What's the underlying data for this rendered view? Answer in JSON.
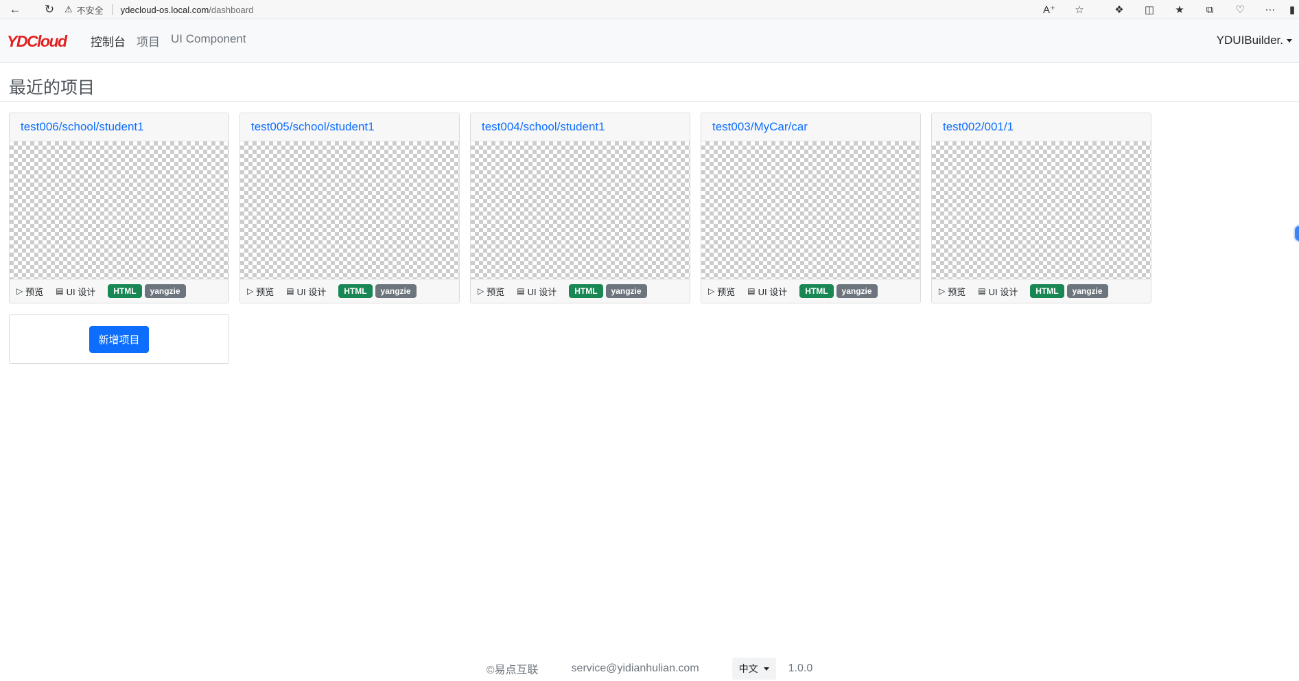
{
  "browser": {
    "insecure_label": "不安全",
    "url_host": "ydecloud-os.local.com",
    "url_path": "/dashboard"
  },
  "navbar": {
    "brand": "YDCloud",
    "links": [
      {
        "label": "控制台",
        "active": true
      },
      {
        "label": "项目",
        "active": false
      },
      {
        "label": "UI Component",
        "active": false
      }
    ],
    "user": "YDUIBuilder."
  },
  "page": {
    "title": "最近的项目"
  },
  "projects": [
    {
      "title": "test006/school/student1",
      "preview": "预览",
      "design": "UI 设计",
      "type": "HTML",
      "owner": "yangzie"
    },
    {
      "title": "test005/school/student1",
      "preview": "预览",
      "design": "UI 设计",
      "type": "HTML",
      "owner": "yangzie"
    },
    {
      "title": "test004/school/student1",
      "preview": "预览",
      "design": "UI 设计",
      "type": "HTML",
      "owner": "yangzie"
    },
    {
      "title": "test003/MyCar/car",
      "preview": "预览",
      "design": "UI 设计",
      "type": "HTML",
      "owner": "yangzie"
    },
    {
      "title": "test002/001/1",
      "preview": "预览",
      "design": "UI 设计",
      "type": "HTML",
      "owner": "yangzie"
    }
  ],
  "add_project_label": "新增项目",
  "footer": {
    "copyright": "©易点互联",
    "email": "service@yidianhulian.com",
    "language": "中文",
    "version": "1.0.0"
  },
  "colors": {
    "primary": "#0d6efd",
    "success": "#198754",
    "secondary": "#6c757d",
    "brand_red": "#e0211f"
  }
}
